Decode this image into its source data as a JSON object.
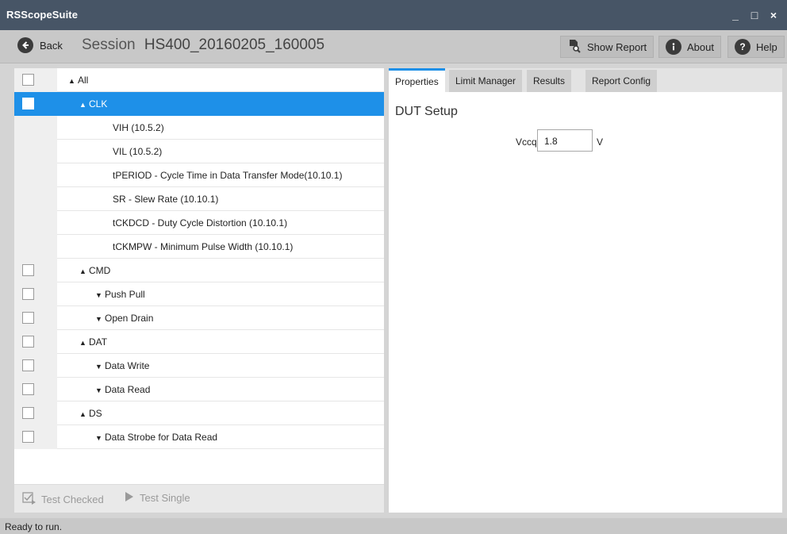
{
  "app": {
    "title": "RSScopeSuite"
  },
  "window_controls": {
    "minimize": "_",
    "maximize": "□",
    "close": "×"
  },
  "toolbar": {
    "back_label": "Back",
    "session_label": "Session",
    "session_value": "HS400_20160205_160005",
    "show_report_label": "Show Report",
    "about_label": "About",
    "help_label": "Help"
  },
  "tree": {
    "rows": [
      {
        "label": "All",
        "level": 0,
        "arrow": "up",
        "checkbox": true,
        "selected": false
      },
      {
        "label": "CLK",
        "level": 1,
        "arrow": "up",
        "checkbox": true,
        "selected": true
      },
      {
        "label": "VIH (10.5.2)",
        "level": 2,
        "arrow": null,
        "checkbox": false,
        "selected": false
      },
      {
        "label": "VIL (10.5.2)",
        "level": 2,
        "arrow": null,
        "checkbox": false,
        "selected": false
      },
      {
        "label": "tPERIOD - Cycle Time in Data Transfer Mode(10.10.1)",
        "level": 2,
        "arrow": null,
        "checkbox": false,
        "selected": false
      },
      {
        "label": "SR - Slew Rate (10.10.1)",
        "level": 2,
        "arrow": null,
        "checkbox": false,
        "selected": false
      },
      {
        "label": "tCKDCD - Duty Cycle Distortion (10.10.1)",
        "level": 2,
        "arrow": null,
        "checkbox": false,
        "selected": false
      },
      {
        "label": "tCKMPW - Minimum Pulse Width (10.10.1)",
        "level": 2,
        "arrow": null,
        "checkbox": false,
        "selected": false
      },
      {
        "label": "CMD",
        "level": 1,
        "arrow": "up",
        "checkbox": true,
        "selected": false
      },
      {
        "label": "Push Pull",
        "level": 2,
        "arrow": "down",
        "checkbox": true,
        "selected": false
      },
      {
        "label": "Open Drain",
        "level": 2,
        "arrow": "down",
        "checkbox": true,
        "selected": false
      },
      {
        "label": "DAT",
        "level": 1,
        "arrow": "up",
        "checkbox": true,
        "selected": false
      },
      {
        "label": "Data Write",
        "level": 2,
        "arrow": "down",
        "checkbox": true,
        "selected": false
      },
      {
        "label": "Data Read",
        "level": 2,
        "arrow": "down",
        "checkbox": true,
        "selected": false
      },
      {
        "label": "DS",
        "level": 1,
        "arrow": "up",
        "checkbox": true,
        "selected": false
      },
      {
        "label": "Data Strobe for Data Read",
        "level": 2,
        "arrow": "down",
        "checkbox": true,
        "selected": false
      }
    ]
  },
  "bottom_buttons": {
    "test_checked_label": "Test Checked",
    "test_single_label": "Test Single"
  },
  "tabs": [
    {
      "label": "Properties",
      "active": true
    },
    {
      "label": "Limit Manager",
      "active": false
    },
    {
      "label": "Results",
      "active": false
    },
    {
      "label": "Report Config",
      "active": false
    }
  ],
  "properties": {
    "section_title": "DUT Setup",
    "vccq_label": "Vccq",
    "vccq_value": "1.8",
    "vccq_unit": "V"
  },
  "status": {
    "text": "Ready to run."
  },
  "colors": {
    "selection": "#1e90e8",
    "titlebar": "#475566",
    "accent": "#1e90e8"
  }
}
